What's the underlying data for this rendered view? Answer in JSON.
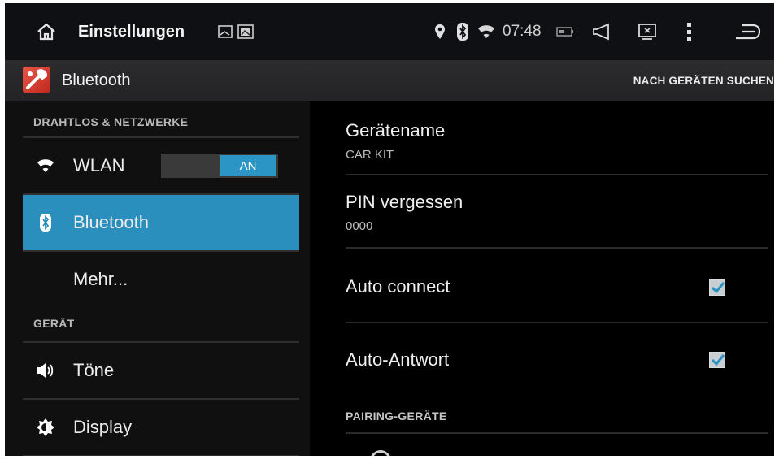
{
  "status_bar": {
    "title": "Einstellungen",
    "time": "07:48",
    "icons": [
      "home-icon",
      "gallery-icon",
      "image-icon",
      "location-icon",
      "bluetooth-icon",
      "wifi-icon",
      "battery-icon",
      "volume-icon",
      "screenshot-icon",
      "menu-dots-icon",
      "back-icon"
    ]
  },
  "action_bar": {
    "title": "Bluetooth",
    "icon": "settings-app-icon",
    "action_label": "NACH GERÄTEN SUCHEN"
  },
  "left_pane": {
    "section_wireless": "DRAHTLOS & NETZWERKE",
    "wlan_label": "WLAN",
    "wlan_toggle": "AN",
    "bluetooth_label": "Bluetooth",
    "more_label": "Mehr...",
    "section_device": "GERÄT",
    "sound_label": "Töne",
    "display_label": "Display"
  },
  "right_pane": {
    "device_name_title": "Gerätename",
    "device_name_value": "CAR KIT",
    "pin_title": "PIN vergessen",
    "pin_value": "0000",
    "auto_connect_label": "Auto connect",
    "auto_connect_checked": true,
    "auto_answer_label": "Auto-Antwort",
    "auto_answer_checked": true,
    "pairing_section": "PAIRING-GERÄTE"
  },
  "colors": {
    "accent": "#2a8fbd",
    "status_bar_bg": "#0f1013",
    "action_bar_bg": "#2a2a2c",
    "left_pane_bg": "#101010",
    "right_pane_bg": "#000000"
  }
}
